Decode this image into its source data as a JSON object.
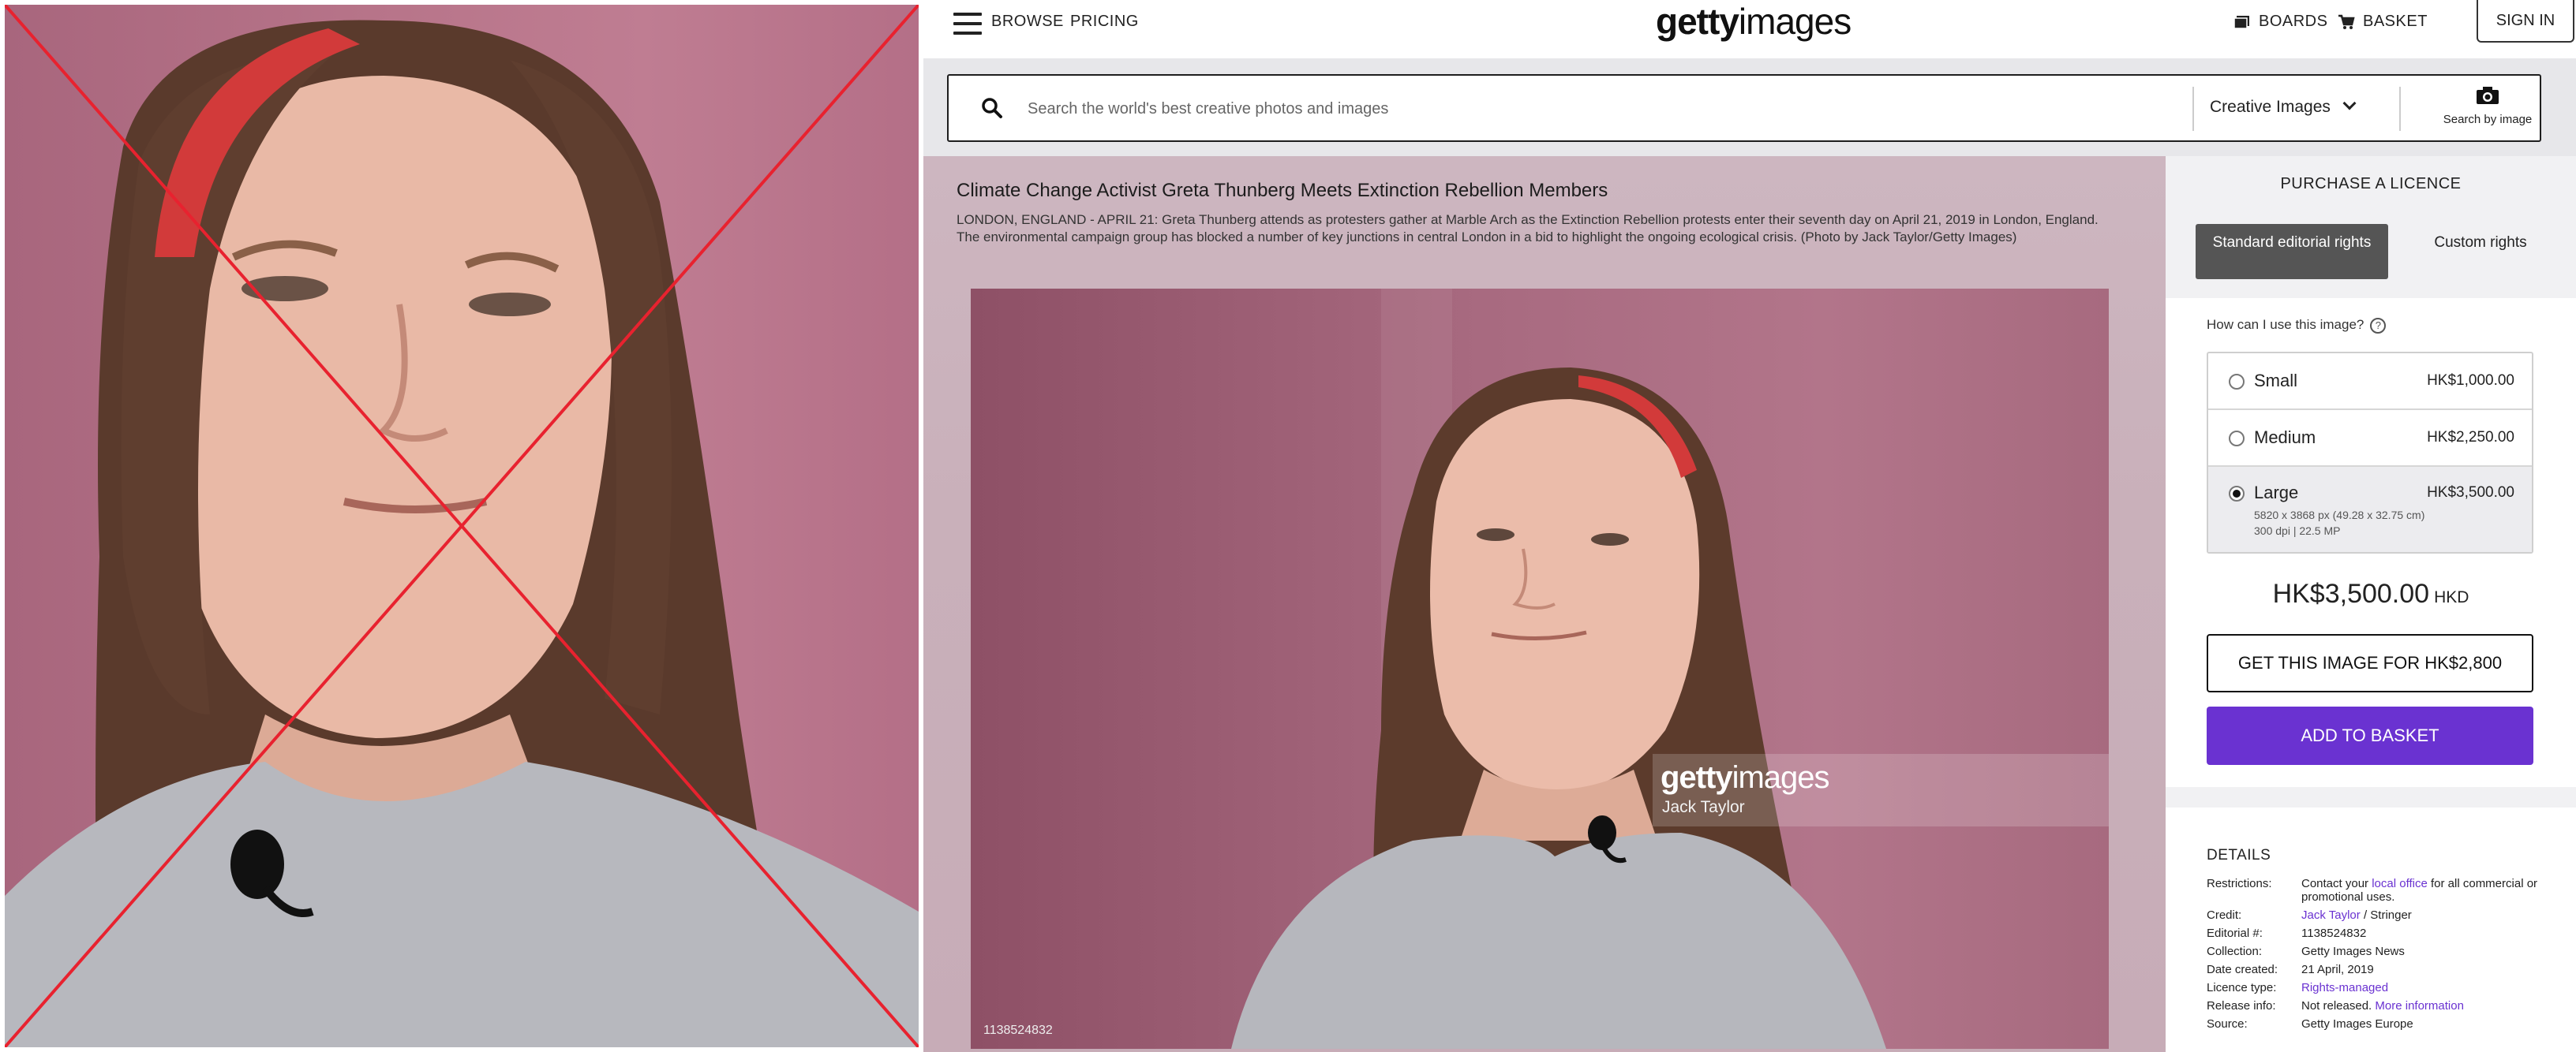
{
  "header": {
    "browse": "BROWSE",
    "pricing": "PRICING",
    "logo_bold": "getty",
    "logo_light": "images",
    "boards": "BOARDS",
    "basket": "BASKET",
    "signin": "SIGN IN"
  },
  "search": {
    "placeholder": "Search the world's best creative photos and images",
    "category": "Creative Images",
    "by_image": "Search by image"
  },
  "image": {
    "title": "Climate Change Activist Greta Thunberg Meets Extinction Rebellion Members",
    "caption": "LONDON, ENGLAND - APRIL 21: Greta Thunberg attends as protesters gather at Marble Arch as the Extinction Rebellion protests enter their seventh day on April 21, 2019 in London, England. The environmental campaign group has blocked a number of key junctions in central London in a bid to highlight the ongoing ecological crisis. (Photo by Jack Taylor/Getty Images)",
    "watermark_bold": "getty",
    "watermark_light": "images",
    "watermark_credit": "Jack Taylor",
    "id": "1138524832"
  },
  "purchase": {
    "title": "PURCHASE A LICENCE",
    "rights_standard": "Standard editorial rights",
    "rights_custom": "Custom rights",
    "how_use": "How can I use this image?",
    "sizes": [
      {
        "name": "Small",
        "price": "HK$1,000.00",
        "selected": false
      },
      {
        "name": "Medium",
        "price": "HK$2,250.00",
        "selected": false
      },
      {
        "name": "Large",
        "price": "HK$3,500.00",
        "selected": true,
        "meta1": "5820 x 3868 px (49.28 x 32.75 cm)",
        "meta2": "300 dpi | 22.5 MP"
      }
    ],
    "total": "HK$3,500.00",
    "currency": "HKD",
    "get_button": "GET THIS IMAGE FOR HK$2,800",
    "basket_button": "ADD TO BASKET"
  },
  "details": {
    "title": "DETAILS",
    "restrictions_label": "Restrictions:",
    "restrictions_pre": "Contact your",
    "restrictions_link": "local office",
    "restrictions_post": "for all commercial or promotional uses.",
    "credit_label": "Credit:",
    "credit_link": "Jack Taylor",
    "credit_post": "/ Stringer",
    "editorial_label": "Editorial #:",
    "editorial": "1138524832",
    "collection_label": "Collection:",
    "collection": "Getty Images News",
    "date_label": "Date created:",
    "date": "21 April, 2019",
    "licence_label": "Licence type:",
    "licence": "Rights-managed",
    "release_label": "Release info:",
    "release": "Not released.",
    "release_link": "More information",
    "source_label": "Source:",
    "source": "Getty Images Europe"
  },
  "colors": {
    "accent": "#6a32d1",
    "cross": "#e8222f"
  }
}
